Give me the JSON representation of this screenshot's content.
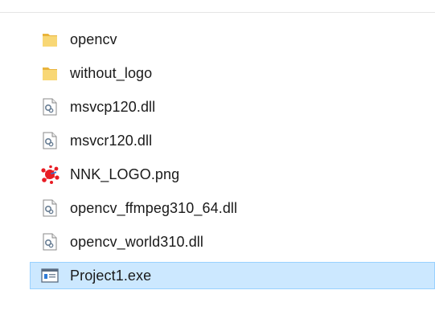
{
  "files": [
    {
      "name": "opencv",
      "icon": "folder-icon",
      "selected": false
    },
    {
      "name": "without_logo",
      "icon": "folder-icon",
      "selected": false
    },
    {
      "name": "msvcp120.dll",
      "icon": "dll-file-icon",
      "selected": false
    },
    {
      "name": "msvcr120.dll",
      "icon": "dll-file-icon",
      "selected": false
    },
    {
      "name": "NNK_LOGO.png",
      "icon": "image-file-icon",
      "selected": false
    },
    {
      "name": "opencv_ffmpeg310_64.dll",
      "icon": "dll-file-icon",
      "selected": false
    },
    {
      "name": "opencv_world310.dll",
      "icon": "dll-file-icon",
      "selected": false
    },
    {
      "name": "Project1.exe",
      "icon": "exe-file-icon",
      "selected": true
    }
  ],
  "colors": {
    "selection_bg": "#cce8ff",
    "selection_border": "#99d1ff",
    "folder": "#f8d775",
    "logo_red": "#e81c24"
  }
}
